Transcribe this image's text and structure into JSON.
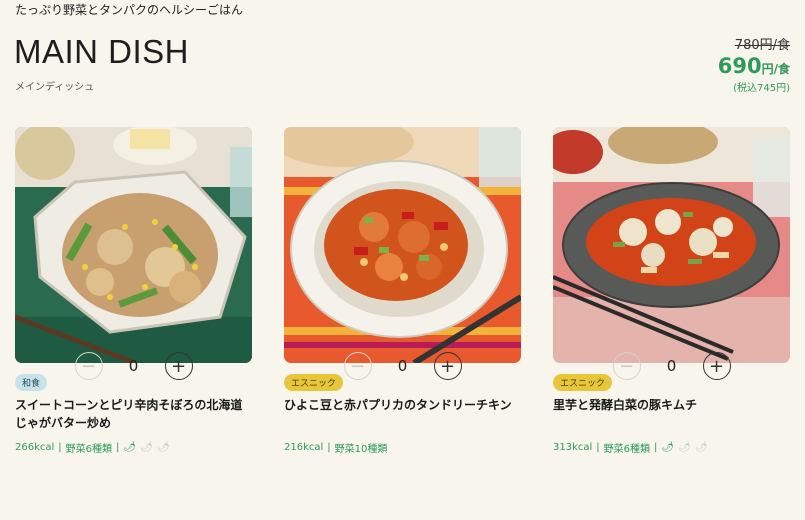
{
  "header": {
    "tagline": "たっぷり野菜とタンパクのヘルシーごはん",
    "title": "MAIN DISH",
    "subtitle": "メインディッシュ",
    "old_price": "780円/食",
    "new_price": "690",
    "new_price_unit": "円/食",
    "tax_note": "(税込745円)"
  },
  "colors": {
    "accent_green": "#2e9a5a",
    "badge_jp": "#c6e3ea",
    "badge_ethnic": "#e8c63a"
  },
  "items": [
    {
      "badge": "和食",
      "name": "スイートコーンとピリ辛肉そぼろの北海道じゃがバター炒め",
      "kcal": "266kcal",
      "veg": "野菜6種類",
      "spice_level": 1,
      "quantity": "0"
    },
    {
      "badge": "エスニック",
      "name": "ひよこ豆と赤パプリカのタンドリーチキン",
      "kcal": "216kcal",
      "veg": "野菜10種類",
      "quantity": "0"
    },
    {
      "badge": "エスニック",
      "name": "里芋と発酵白菜の豚キムチ",
      "kcal": "313kcal",
      "veg": "野菜6種類",
      "spice_level": 1,
      "quantity": "0"
    }
  ],
  "icons": {
    "minus": "minus-icon",
    "plus": "plus-icon",
    "chili": "chili-icon"
  }
}
